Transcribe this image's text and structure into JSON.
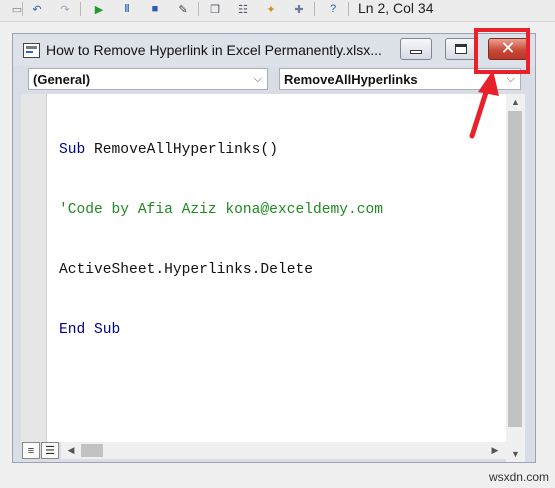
{
  "toolbar": {
    "icons": [
      "undo-icon",
      "redo-icon",
      "run-icon",
      "pause-icon",
      "reset-icon",
      "design-mode-icon",
      "project-explorer-icon",
      "properties-icon",
      "object-browser-icon",
      "toolbox-icon",
      "help-icon"
    ],
    "status": "Ln 2, Col 34"
  },
  "window": {
    "title": "How to Remove Hyperlink in Excel Permanently.xlsx...",
    "object_combo": "(General)",
    "procedure_combo": "RemoveAllHyperlinks"
  },
  "code": {
    "line1_keyword": "Sub",
    "line1_name": " RemoveAllHyperlinks()",
    "line2_comment": "'Code by Afia Aziz kona@exceldemy.com",
    "line3": "ActiveSheet.Hyperlinks.Delete",
    "line4_keyword": "End Sub"
  },
  "colors": {
    "keyword": "#00008b",
    "comment": "#1f8a1f",
    "highlight": "#e8212a"
  },
  "watermark": "wsxdn.com"
}
